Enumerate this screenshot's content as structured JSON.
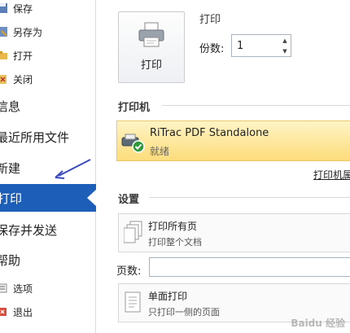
{
  "nav": {
    "save": "保存",
    "save_as": "另存为",
    "open": "打开",
    "close": "关闭",
    "info": "信息",
    "recent": "最近所用文件",
    "new": "新建",
    "print": "打印",
    "save_send": "保存并发送",
    "help": "帮助",
    "options": "选项",
    "exit": "退出"
  },
  "print_section": {
    "title": "打印",
    "button_label": "打印",
    "copies_label": "份数:",
    "copies_value": "1"
  },
  "printer_section": {
    "title": "打印机",
    "printer_name": "RiTrac PDF Standalone",
    "printer_status": "就绪",
    "properties_link": "打印机属性"
  },
  "settings_section": {
    "title": "设置",
    "print_all_title": "打印所有页",
    "print_all_sub": "打印整个文档",
    "pages_label": "页数:",
    "pages_value": "",
    "duplex_title": "单面打印",
    "duplex_sub": "只打印一侧的页面"
  },
  "watermark": "Baidu 经验",
  "colors": {
    "accent": "#1d5fb8",
    "printer_highlight": "#fddc7b",
    "annotation_arrow": "#3b4bbd"
  }
}
